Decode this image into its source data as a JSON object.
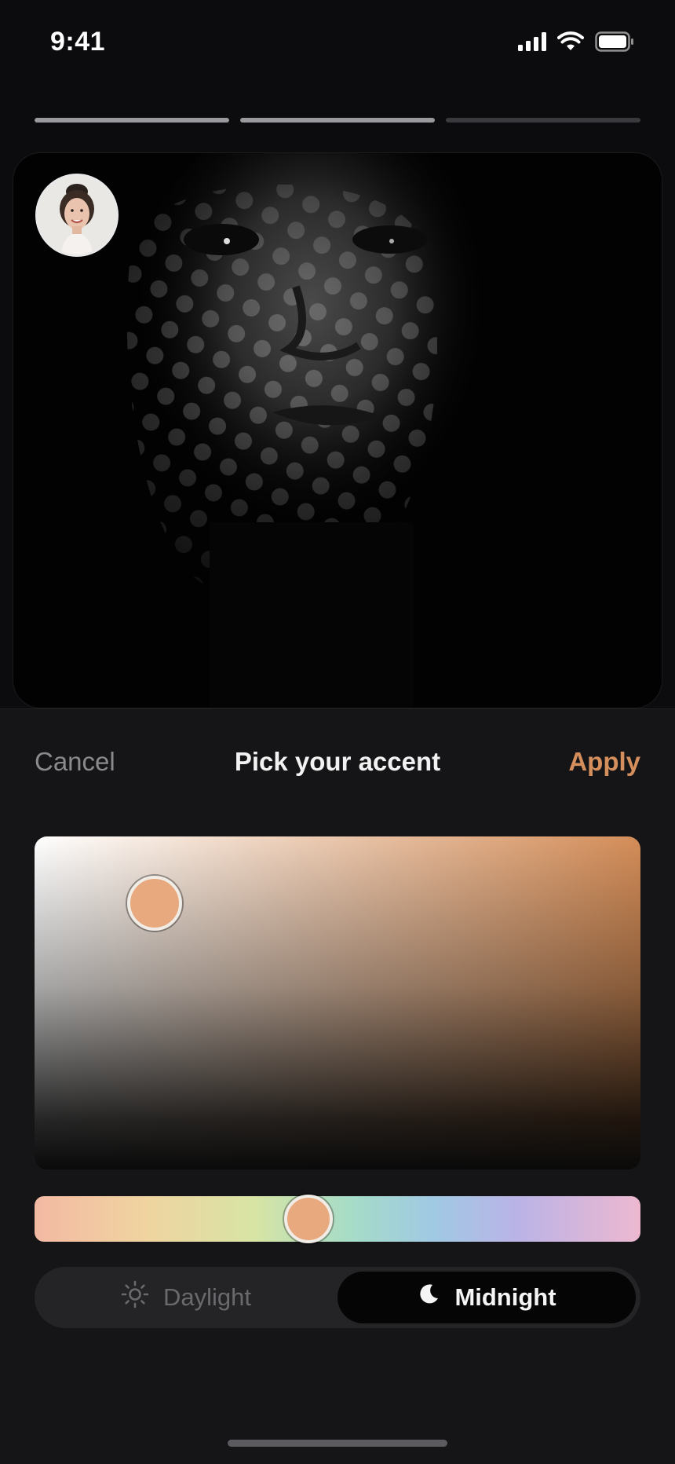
{
  "status_bar": {
    "time": "9:41"
  },
  "story_progress": {
    "segments": [
      1.0,
      1.0,
      0.0
    ]
  },
  "sheet": {
    "cancel_label": "Cancel",
    "title": "Pick your accent",
    "apply_label": "Apply"
  },
  "color_picker": {
    "selected_color": "#e7a97d",
    "hue_gradient_colors": [
      "#f3b9a3",
      "#f0d3a0",
      "#d8e4a4",
      "#a6dcc7",
      "#a0c9e4",
      "#bbb3e6",
      "#edb8d0"
    ],
    "hue_position": 0.45
  },
  "appearance_toggle": {
    "options": [
      {
        "label": "Daylight",
        "icon": "sun-icon",
        "selected": false
      },
      {
        "label": "Midnight",
        "icon": "moon-icon",
        "selected": true
      }
    ]
  },
  "colors": {
    "accent": "#d58f5c",
    "background": "#0c0c0e",
    "sheet_background": "#151517"
  }
}
